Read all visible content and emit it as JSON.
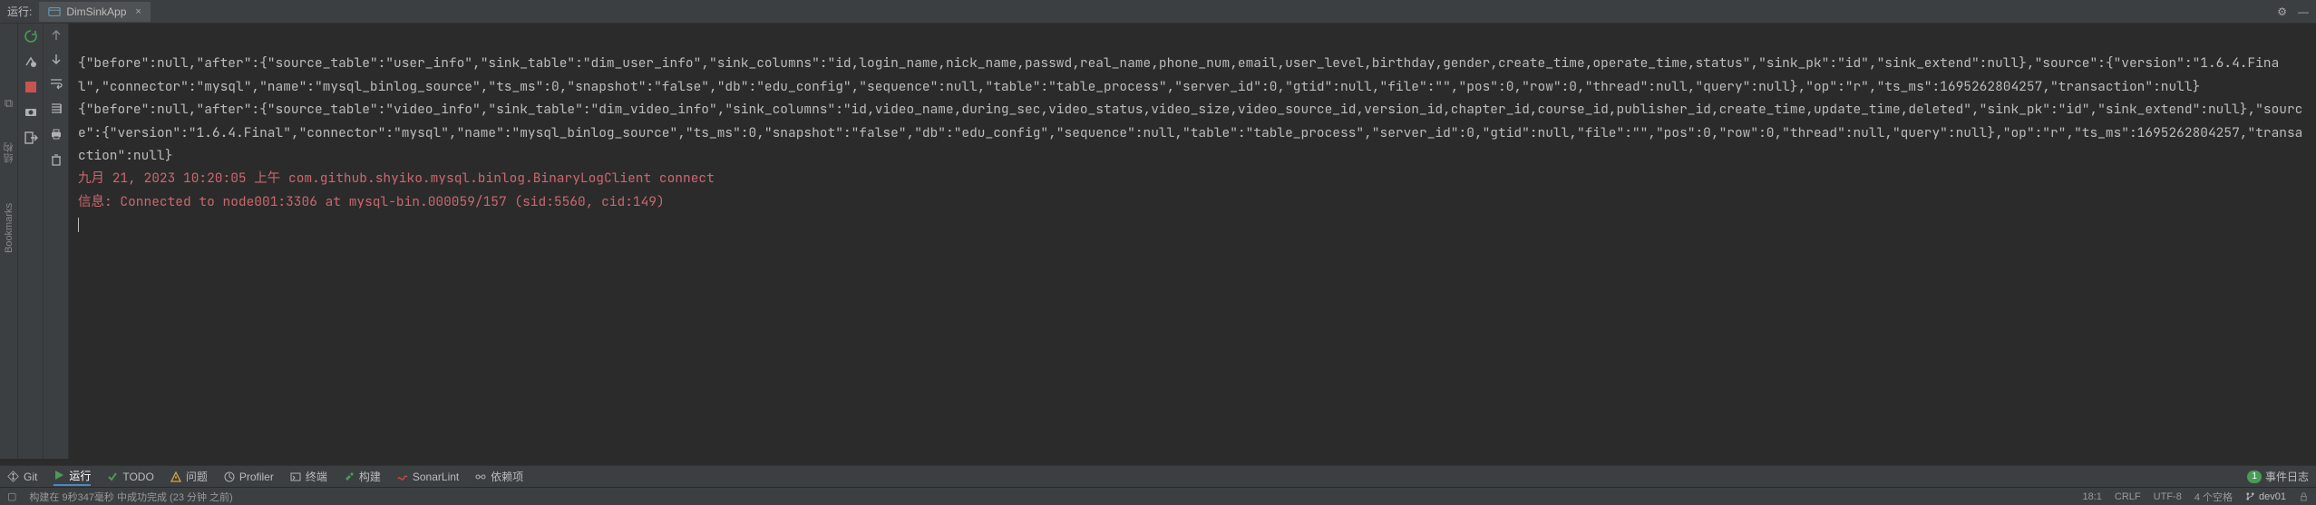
{
  "header": {
    "run_label": "运行:",
    "tab_name": "DimSinkApp",
    "close_glyph": "×",
    "gear_glyph": "⚙",
    "minimize_glyph": "—"
  },
  "sidebar": {
    "structure_label": "结构",
    "bookmarks_label": "Bookmarks"
  },
  "console": {
    "line1": "{\"before\":null,\"after\":{\"source_table\":\"user_info\",\"sink_table\":\"dim_user_info\",\"sink_columns\":\"id,login_name,nick_name,passwd,real_name,phone_num,email,user_level,birthday,gender,create_time,operate_time,status\",\"sink_pk\":\"id\",\"sink_extend\":null},\"source\":{\"version\":\"1.6.4.Final\",\"connector\":\"mysql\",\"name\":\"mysql_binlog_source\",\"ts_ms\":0,\"snapshot\":\"false\",\"db\":\"edu_config\",\"sequence\":null,\"table\":\"table_process\",\"server_id\":0,\"gtid\":null,\"file\":\"\",\"pos\":0,\"row\":0,\"thread\":null,\"query\":null},\"op\":\"r\",\"ts_ms\":1695262804257,\"transaction\":null}",
    "line2": "{\"before\":null,\"after\":{\"source_table\":\"video_info\",\"sink_table\":\"dim_video_info\",\"sink_columns\":\"id,video_name,during_sec,video_status,video_size,video_source_id,version_id,chapter_id,course_id,publisher_id,create_time,update_time,deleted\",\"sink_pk\":\"id\",\"sink_extend\":null},\"source\":{\"version\":\"1.6.4.Final\",\"connector\":\"mysql\",\"name\":\"mysql_binlog_source\",\"ts_ms\":0,\"snapshot\":\"false\",\"db\":\"edu_config\",\"sequence\":null,\"table\":\"table_process\",\"server_id\":0,\"gtid\":null,\"file\":\"\",\"pos\":0,\"row\":0,\"thread\":null,\"query\":null},\"op\":\"r\",\"ts_ms\":1695262804257,\"transaction\":null}",
    "line3": "九月 21, 2023 10:20:05 上午 com.github.shyiko.mysql.binlog.BinaryLogClient connect",
    "line4": "信息: Connected to node001:3306 at mysql-bin.000059/157 (sid:5560, cid:149)"
  },
  "bottom_tabs": {
    "git": "Git",
    "run": "运行",
    "todo": "TODO",
    "problems": "问题",
    "profiler": "Profiler",
    "terminal": "终端",
    "build": "构建",
    "sonarlint": "SonarLint",
    "dependencies": "依赖项",
    "event_log": "事件日志",
    "event_badge": "1"
  },
  "status": {
    "build_msg": "构建在 9秒347毫秒 中成功完成 (23 分钟 之前)",
    "cursor": "18:1",
    "line_sep": "CRLF",
    "encoding": "UTF-8",
    "indent": "4 个空格",
    "branch": "dev01"
  },
  "colors": {
    "green": "#499c54",
    "red": "#c75450",
    "orange": "#d9a343",
    "blue": "#4a88c7",
    "gray": "#afb1b3"
  }
}
